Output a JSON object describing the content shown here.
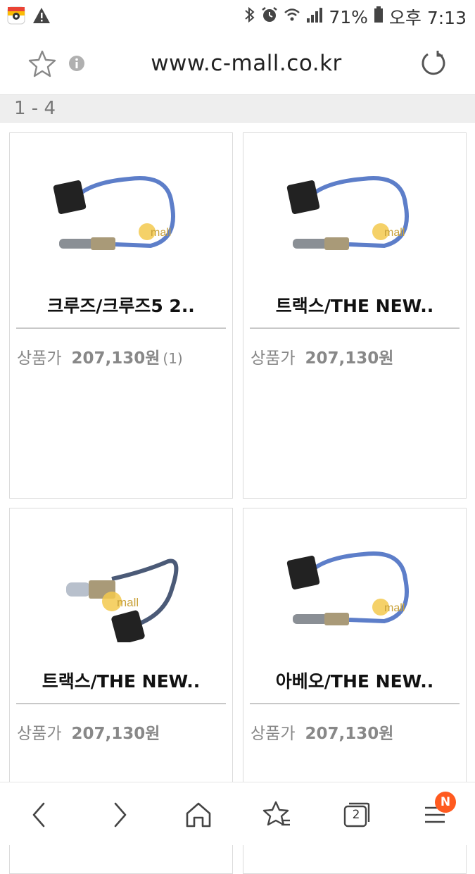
{
  "status_bar": {
    "battery_percent": "71%",
    "time": "오후 7:13"
  },
  "browser": {
    "url": "www.c-mall.co.kr",
    "tab_count": "2",
    "menu_badge": "N"
  },
  "results": {
    "range": "1 - 4"
  },
  "products": [
    {
      "name": "크루즈/크루즈5 2..",
      "price_label": "상품가",
      "price": "207,130원",
      "review_count": "(1)"
    },
    {
      "name": "트랙스/THE NEW..",
      "price_label": "상품가",
      "price": "207,130원",
      "review_count": ""
    },
    {
      "name": "트랙스/THE NEW..",
      "price_label": "상품가",
      "price": "207,130원",
      "review_count": ""
    },
    {
      "name": "아베오/THE NEW..",
      "price_label": "상품가",
      "price": "207,130원",
      "review_count": ""
    }
  ],
  "colors": {
    "cable_blue": "#5d7ec9",
    "badge_orange": "#ff5a1f",
    "range_bg": "#eeeeee"
  }
}
